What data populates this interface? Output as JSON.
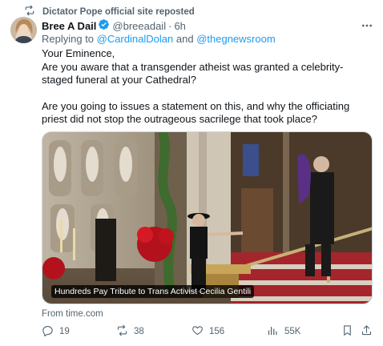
{
  "repost": {
    "icon": "repost-icon",
    "text": "Dictator Pope official site reposted"
  },
  "tweet": {
    "author_name": "Bree A Dail",
    "handle": "@breeadail",
    "separator": "·",
    "time": "6h",
    "replying_prefix": "Replying to",
    "mentions": [
      "@CardinalDolan",
      "@thegnewsroom"
    ],
    "mention_joiner": "and",
    "paragraphs": [
      "Your Eminence,\nAre you aware that a transgender atheist was granted a celebrity-staged funeral at your Cathedral?",
      "Are you going to issues a statement on this, and why the officiating priest did not stop the outrageous sacrilege that took place?"
    ],
    "media_caption": "Hundreds Pay Tribute to Trans Activist Cecilia Gentili",
    "source_link": "From time.com"
  },
  "actions": {
    "replies": "19",
    "reposts": "38",
    "likes": "156",
    "views": "55K"
  },
  "colors": {
    "text": "#0f1419",
    "secondary": "#536471",
    "link": "#1d9bf0",
    "verified": "#1d9bf0"
  }
}
